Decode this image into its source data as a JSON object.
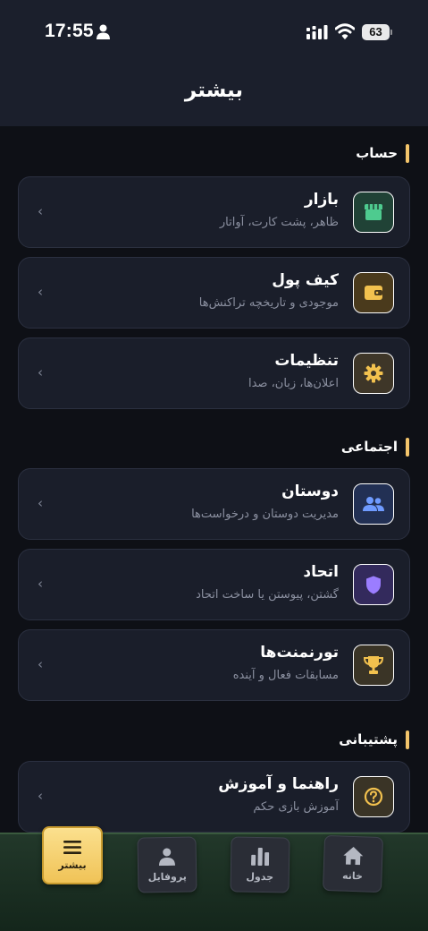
{
  "status_bar": {
    "time": "17:55",
    "battery": "63"
  },
  "header": {
    "title": "بیشتر"
  },
  "sections": [
    {
      "title": "حساب",
      "items": [
        {
          "title": "بازار",
          "subtitle": "ظاهر، پشت کارت، آواتار",
          "icon": "store-icon"
        },
        {
          "title": "کیف پول",
          "subtitle": "موجودی و تاریخچه تراکنش‌ها",
          "icon": "wallet-icon"
        },
        {
          "title": "تنظیمات",
          "subtitle": "اعلان‌ها، زبان، صدا",
          "icon": "gear-icon"
        }
      ]
    },
    {
      "title": "اجتماعی",
      "items": [
        {
          "title": "دوستان",
          "subtitle": "مدیریت دوستان و درخواست‌ها",
          "icon": "people-icon"
        },
        {
          "title": "اتحاد",
          "subtitle": "گشتن، پیوستن یا ساخت اتحاد",
          "icon": "shield-icon"
        },
        {
          "title": "تورنمنت‌ها",
          "subtitle": "مسابقات فعال و آینده",
          "icon": "trophy-icon"
        }
      ]
    },
    {
      "title": "پشتیبانی",
      "items": [
        {
          "title": "راهنما و آموزش",
          "subtitle": "آموزش بازی حکم",
          "icon": "help-icon"
        }
      ]
    }
  ],
  "chevron": "‹",
  "tabs": [
    {
      "label": "بیشتر",
      "icon": "menu-icon",
      "active": true
    },
    {
      "label": "پروفایل",
      "icon": "person-icon",
      "active": false
    },
    {
      "label": "جدول",
      "icon": "chart-icon",
      "active": false
    },
    {
      "label": "خانه",
      "icon": "home-icon",
      "active": false
    }
  ],
  "colors": {
    "background": "#0e1016",
    "header": "#1b1f2c",
    "card": "#1a1e2a",
    "accent_gold": "#f4c56b",
    "tabbar": "#1c3022"
  }
}
